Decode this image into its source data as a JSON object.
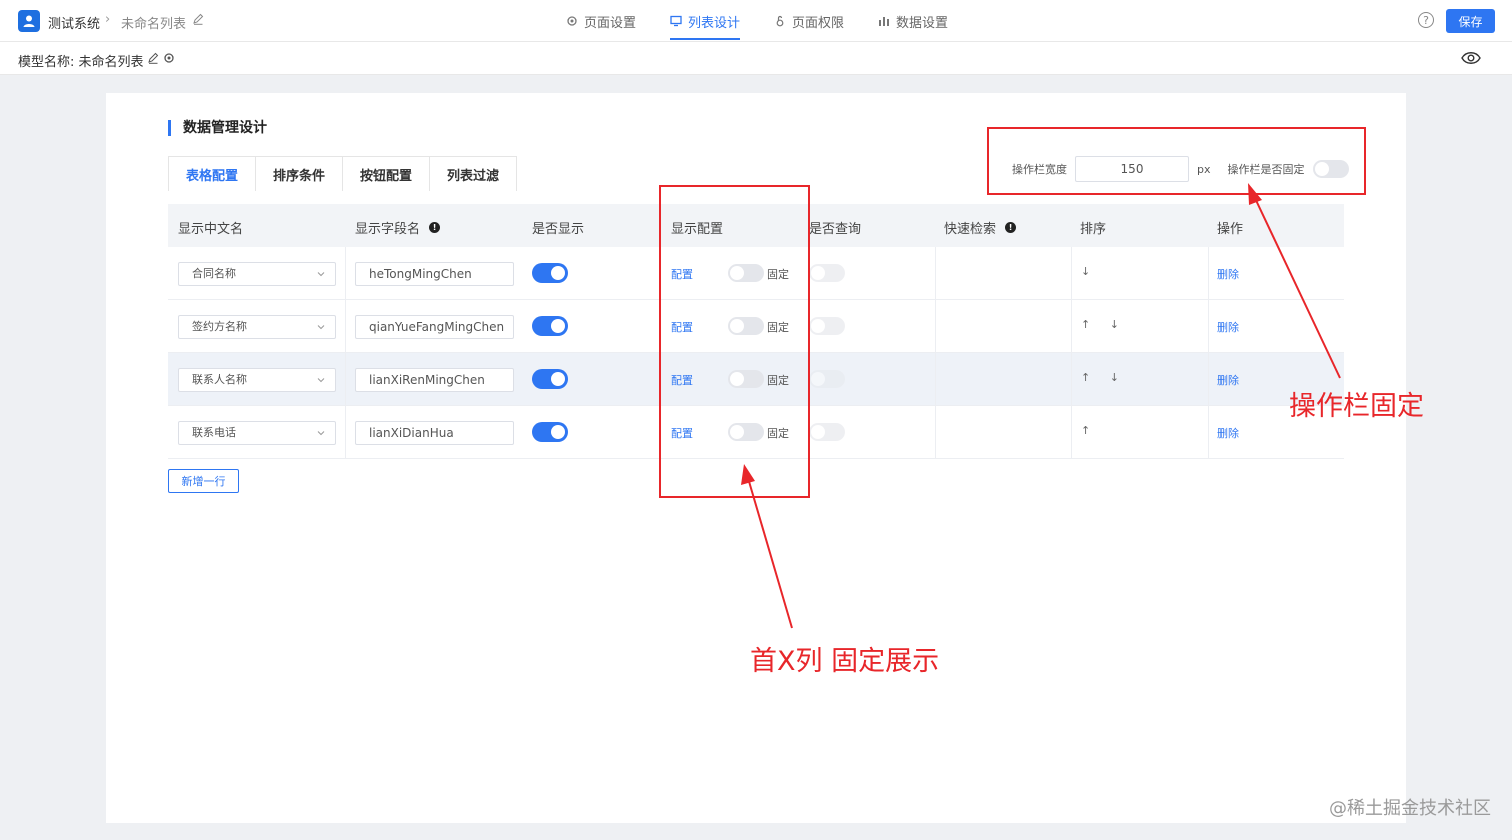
{
  "header": {
    "app_name": "测试系统",
    "crumb_sep": "›",
    "crumb_page": "未命名列表",
    "tabs": [
      {
        "label": "页面设置",
        "icon": "gear-icon"
      },
      {
        "label": "列表设计",
        "icon": "list-icon"
      },
      {
        "label": "页面权限",
        "icon": "lock-icon"
      },
      {
        "label": "数据设置",
        "icon": "bar-chart-icon"
      }
    ],
    "help_glyph": "?",
    "save_label": "保存",
    "accent": "#2e76f2"
  },
  "subbar": {
    "model_label": "模型名称: 未命名列表"
  },
  "card": {
    "title": "数据管理设计",
    "sub_tabs": [
      "表格配置",
      "排序条件",
      "按钮配置",
      "列表过滤"
    ],
    "op_width_label": "操作栏宽度",
    "op_width_value": "150",
    "op_width_unit": "px",
    "op_fixed_label": "操作栏是否固定",
    "columns": [
      "显示中文名",
      "显示字段名",
      "是否显示",
      "显示配置",
      "是否查询",
      "快速检索",
      "排序",
      "操作"
    ],
    "info_glyph": "!",
    "rows": [
      {
        "cn_name": "合同名称",
        "field": "heTongMingChen",
        "config": "配置",
        "fixed": "固定",
        "sort": "↓",
        "action": "删除"
      },
      {
        "cn_name": "签约方名称",
        "field": "qianYueFangMingChen",
        "config": "配置",
        "fixed": "固定",
        "sort": "↑ ↓",
        "action": "删除"
      },
      {
        "cn_name": "联系人名称",
        "field": "lianXiRenMingChen",
        "config": "配置",
        "fixed": "固定",
        "sort": "↑ ↓",
        "action": "删除"
      },
      {
        "cn_name": "联系电话",
        "field": "lianXiDianHua",
        "config": "配置",
        "fixed": "固定",
        "sort": "↑",
        "action": "删除"
      }
    ],
    "add_row_label": "新增一行"
  },
  "annotations": {
    "op_fixed": "操作栏固定",
    "first_x": "首X列 固定展示",
    "color": "#e8262a"
  },
  "watermark": "@稀土掘金技术社区"
}
